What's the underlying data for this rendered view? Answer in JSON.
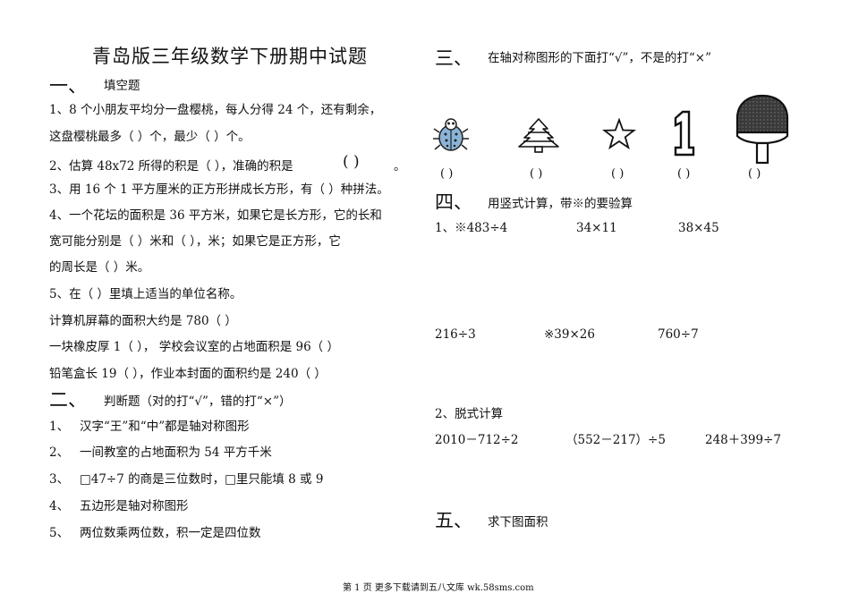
{
  "left": {
    "title": "青岛版三年级数学下册期中试题",
    "section1": {
      "num": "一、",
      "title": "填空题"
    },
    "q1_line1": "1、8 个小朋友平均分一盘樱桃，每人分得 24 个，还有剩余，",
    "q1_line2": "这盘樱桃最多（      ）个，最少（      ）个。",
    "q2_a": "2、估算 48x72 所得的积是（      ），准确的积是",
    "q2_paren": "(      )",
    "q2_end": "。",
    "q3": "3、用 16 个 1 平方厘米的正方形拼成长方形，有（    ）种拼法。",
    "q4_line1": "4、一个花坛的面积是 36 平方米，如果它是长方形，它的长和",
    "q4_line2": "宽可能分别是（      ）米和（    ），米；如果它是正方形，它",
    "q4_line3": "的周长是（      ）米。",
    "q5": "5、在（  ）里填上适当的单位名称。",
    "q5_a": "计算机屏幕的面积大约是 780（      ）",
    "q5_b": "一块橡皮厚 1（      ），    学校会议室的占地面积是 96（    ）",
    "q5_c": "铅笔盒长 19（      ），作业本封面的面积约是 240（      ）",
    "section2": {
      "num": "二、",
      "title": "判断题（对的打“√”，错的打“×”）"
    },
    "j1": {
      "num": "1、",
      "text": "汉字“王”和“中”都是轴对称图形"
    },
    "j2": {
      "num": "2、",
      "text": "一间教室的占地面积为 54 平方千米"
    },
    "j3": {
      "num": "3、",
      "text": "□47÷7 的商是三位数时，□里只能填 8 或 9"
    },
    "j4": {
      "num": "4、",
      "text": "五边形是轴对称图形"
    },
    "j5": {
      "num": "5、",
      "text": "两位数乘两位数，积一定是四位数"
    }
  },
  "right": {
    "section3": {
      "num": "三、",
      "title": "在轴对称图形的下面打“√”，不是的打“×”"
    },
    "figures": [
      {
        "icon": "beetle-icon",
        "paren": "(          )"
      },
      {
        "icon": "tree-icon",
        "paren": "(          )"
      },
      {
        "icon": "star-icon",
        "paren": "(          )"
      },
      {
        "icon": "digit-one-icon",
        "paren": "(          )"
      },
      {
        "icon": "paddle-icon",
        "paren": "(          )"
      }
    ],
    "section4": {
      "num": "四、",
      "title": "用竖式计算，带※的要验算"
    },
    "c1": "1、※483÷4",
    "c2": "34×11",
    "c3": "38×45",
    "c4": "216÷3",
    "c5": "※39×26",
    "c6": "760÷7",
    "sub2": "2、脱式计算",
    "d1": "2010－712÷2",
    "d2": "（552－217）÷5",
    "d3": "248＋399÷7",
    "section5": {
      "num": "五、",
      "title": "求下图面积"
    }
  },
  "footer": "第 1 页 更多下载请到五八文库 wk.58sms.com",
  "colors": {
    "text": "#111111",
    "paddle_fill": "#3a3a3a",
    "beetle_blue": "#8ab4d8"
  }
}
